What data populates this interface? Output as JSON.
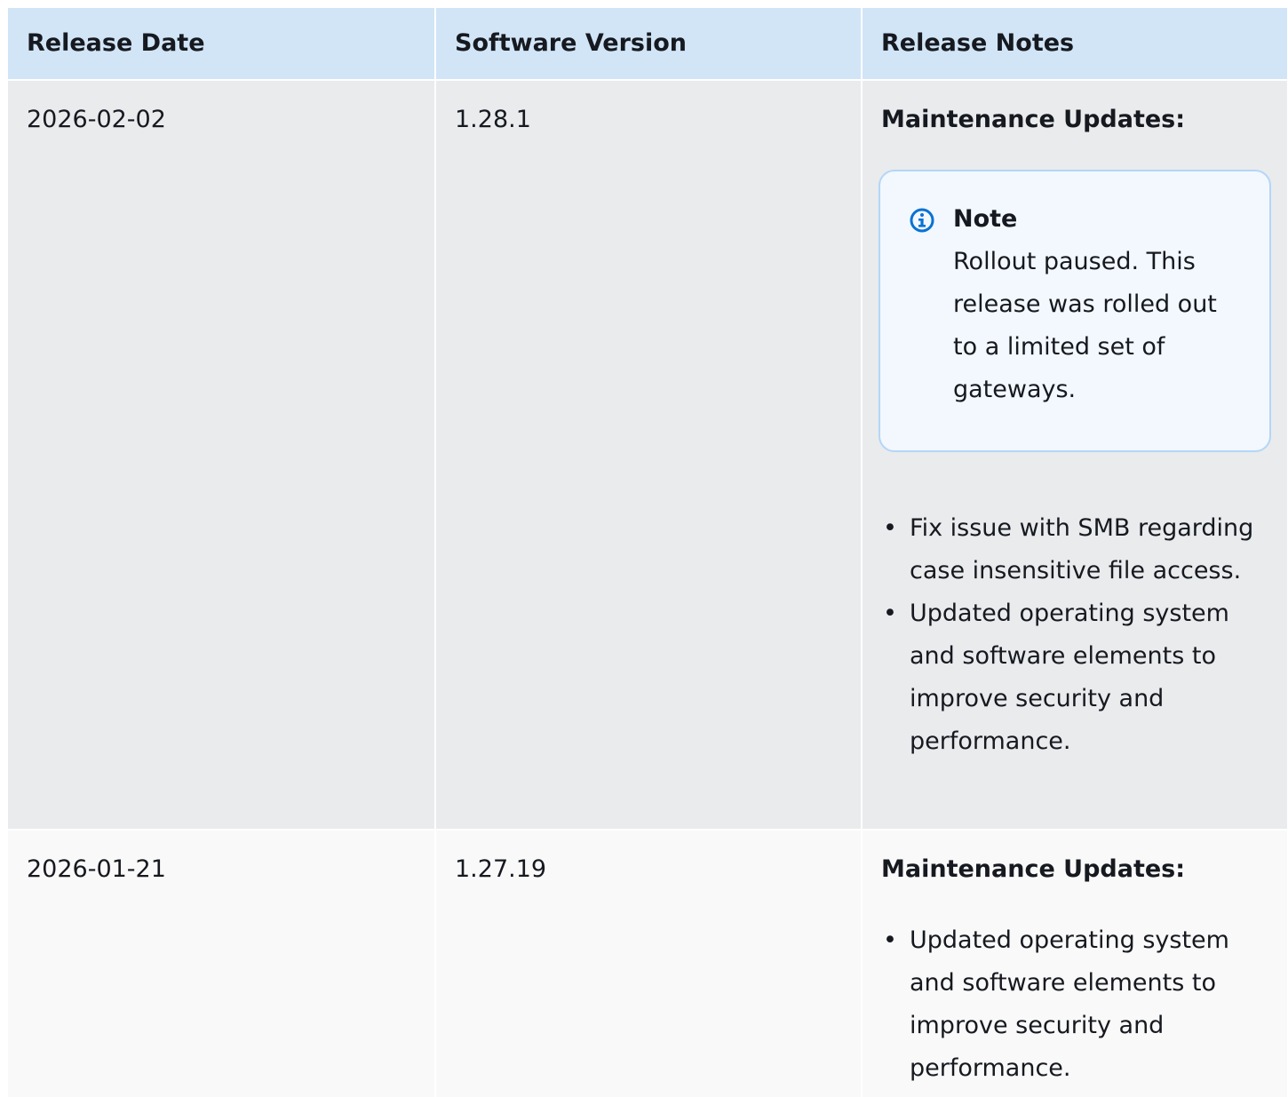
{
  "table": {
    "headers": [
      "Release Date",
      "Software Version",
      "Release Notes"
    ],
    "rows": [
      {
        "release_date": "2026-02-02",
        "software_version": "1.28.1",
        "notes_heading": "Maintenance Updates:",
        "note": {
          "icon": "info-icon",
          "title": "Note",
          "body": "Rollout paused. This release was rolled out to a limited set of gateways."
        },
        "items": [
          "Fix issue with SMB regarding case insensitive file access.",
          "Updated operating system and software elements to improve security and performance."
        ]
      },
      {
        "release_date": "2026-01-21",
        "software_version": "1.27.19",
        "notes_heading": "Maintenance Updates:",
        "items": [
          "Updated operating system and software elements to improve security and performance."
        ]
      }
    ]
  },
  "colors": {
    "header_bg": "#d1e5f7",
    "row_alt_bg": "#e9ebed",
    "row_bg": "#f9f9f9",
    "note_border": "#b4d6f7",
    "note_bg": "#f2f8fd",
    "info_icon": "#0972d3"
  }
}
